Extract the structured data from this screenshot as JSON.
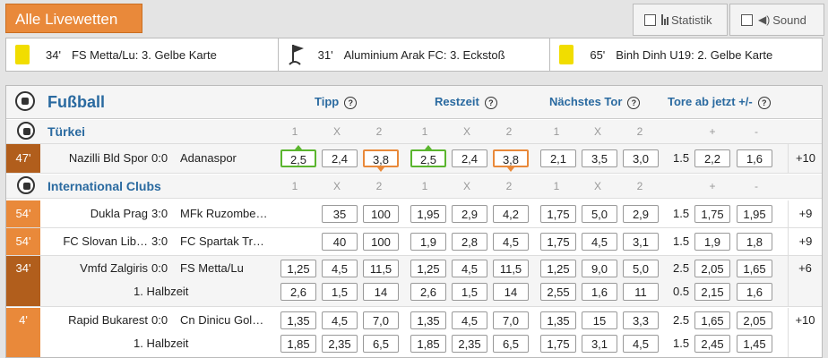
{
  "header": {
    "title": "Alle Livewetten",
    "statistik_label": "Statistik",
    "sound_label": "Sound"
  },
  "events": [
    {
      "minute": "34'",
      "text": "FS Metta/Lu: 3. Gelbe Karte",
      "icon": "yellow-card-icon"
    },
    {
      "minute": "31'",
      "text": "Aluminium Arak FC: 3. Eckstoß",
      "icon": "corner-flag-icon"
    },
    {
      "minute": "65'",
      "text": "Binh Dinh U19: 2. Gelbe Karte",
      "icon": "yellow-card-icon"
    }
  ],
  "section": {
    "sport": "Fußball",
    "tipp": "Tipp",
    "restzeit": "Restzeit",
    "naechstes_tor": "Nächstes Tor",
    "tore_ab_jetzt": "Tore ab jetzt +/-",
    "col_1": "1",
    "col_x": "X",
    "col_2": "2",
    "col_plus": "+",
    "col_minus": "-"
  },
  "leagues": [
    {
      "name": "Türkei"
    },
    {
      "name": "International Clubs"
    }
  ],
  "matches": [
    {
      "minute": "47'",
      "home": "Nazilli Bld Spor",
      "score": "0:0",
      "away": "Adanaspor",
      "tipp": [
        "2,5",
        "2,4",
        "3,8"
      ],
      "rest": [
        "2,5",
        "2,4",
        "3,8"
      ],
      "next": [
        "2,1",
        "3,5",
        "3,0"
      ],
      "line": "1.5",
      "ou": [
        "2,2",
        "1,6"
      ],
      "more": "+10"
    },
    {
      "minute": "54'",
      "home": "Dukla Prag",
      "score": "3:0",
      "away": "MFk Ruzombe…",
      "tipp": [
        "35",
        "100"
      ],
      "rest": [
        "1,95",
        "2,9",
        "4,2"
      ],
      "next": [
        "1,75",
        "5,0",
        "2,9"
      ],
      "line": "1.5",
      "ou": [
        "1,75",
        "1,95"
      ],
      "more": "+9"
    },
    {
      "minute": "54'",
      "home": "FC Slovan Lib…",
      "score": "3:0",
      "away": "FC Spartak Tr…",
      "tipp": [
        "40",
        "100"
      ],
      "rest": [
        "1,9",
        "2,8",
        "4,5"
      ],
      "next": [
        "1,75",
        "4,5",
        "3,1"
      ],
      "line": "1.5",
      "ou": [
        "1,9",
        "1,8"
      ],
      "more": "+9"
    },
    {
      "minute": "34'",
      "home": "Vmfd Zalgiris",
      "score": "0:0",
      "away": "FS Metta/Lu",
      "tipp": [
        "1,25",
        "4,5",
        "11,5"
      ],
      "rest": [
        "1,25",
        "4,5",
        "11,5"
      ],
      "next": [
        "1,25",
        "9,0",
        "5,0"
      ],
      "line": "2.5",
      "ou": [
        "2,05",
        "1,65"
      ],
      "more": "+6",
      "half_label": "1. Halbzeit",
      "half_tipp": [
        "2,6",
        "1,5",
        "14"
      ],
      "half_rest": [
        "2,6",
        "1,5",
        "14"
      ],
      "half_next": [
        "2,55",
        "1,6",
        "11"
      ],
      "half_line": "0.5",
      "half_ou": [
        "2,15",
        "1,6"
      ]
    },
    {
      "minute": "4'",
      "home": "Rapid Bukarest",
      "score": "0:0",
      "away": "Cn Dinicu Gol…",
      "tipp": [
        "1,35",
        "4,5",
        "7,0"
      ],
      "rest": [
        "1,35",
        "4,5",
        "7,0"
      ],
      "next": [
        "1,35",
        "15",
        "3,3"
      ],
      "line": "2.5",
      "ou": [
        "1,65",
        "2,05"
      ],
      "more": "+10",
      "half_label": "1. Halbzeit",
      "half_tipp": [
        "1,85",
        "2,35",
        "6,5"
      ],
      "half_rest": [
        "1,85",
        "2,35",
        "6,5"
      ],
      "half_next": [
        "1,75",
        "3,1",
        "4,5"
      ],
      "half_line": "1.5",
      "half_ou": [
        "2,45",
        "1,45"
      ]
    }
  ]
}
